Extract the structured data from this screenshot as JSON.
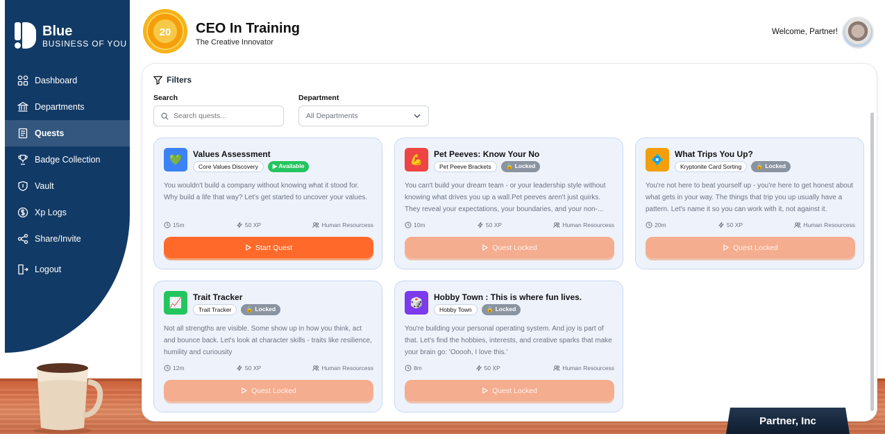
{
  "brand": {
    "title": "Blue",
    "subtitle": "BUSINESS OF YOU"
  },
  "sidebar": {
    "items": [
      {
        "label": "Dashboard",
        "icon": "grid-icon"
      },
      {
        "label": "Departments",
        "icon": "building-icon"
      },
      {
        "label": "Quests",
        "icon": "scroll-icon",
        "active": true
      },
      {
        "label": "Badge Collection",
        "icon": "trophy-icon"
      },
      {
        "label": "Vault",
        "icon": "shield-icon"
      },
      {
        "label": "Xp Logs",
        "icon": "dollar-icon"
      },
      {
        "label": "Share/Invite",
        "icon": "share-icon"
      },
      {
        "label": "Logout",
        "icon": "logout-icon"
      }
    ]
  },
  "header": {
    "level": "20",
    "title": "CEO In Training",
    "subtitle": "The Creative Innovator",
    "welcome": "Welcome, Partner!"
  },
  "filters": {
    "heading": "Filters",
    "search_label": "Search",
    "search_placeholder": "Search quests...",
    "department_label": "Department",
    "department_value": "All Departments"
  },
  "quests": [
    {
      "title": "Values Assessment",
      "tag": "Core Values Discovery",
      "status": "Available",
      "icon_char": "💚",
      "icon_color": "#3b82f6",
      "desc": "You wouldn't build a company without knowing what it stood for. Why build a life that way? Let's get started to uncover your values.",
      "duration": "15m",
      "xp": "50 XP",
      "dept": "Human Resourcess",
      "cta": "Start Quest"
    },
    {
      "title": "Pet Peeves: Know Your No",
      "tag": "Pet Peeve Brackets",
      "status": "Locked",
      "icon_char": "💪",
      "icon_color": "#ef4444",
      "desc": "You can't build your dream team - or your leadership style without knowing what drives you up a wall.Pet peeves aren't just quirks. They reveal your expectations, your boundaries, and your non-...",
      "duration": "10m",
      "xp": "50 XP",
      "dept": "Human Resourcess",
      "cta": "Quest Locked"
    },
    {
      "title": "What Trips You Up?",
      "tag": "Kryptonite Card Sorting",
      "status": "Locked",
      "icon_char": "💠",
      "icon_color": "#f59e0b",
      "desc": "You're not here to beat yourself up - you're here to get honest about what gets in your way. The things that trip you up usually have a pattern. Let's name it so you can work with it, not against it.",
      "duration": "20m",
      "xp": "50 XP",
      "dept": "Human Resourcess",
      "cta": "Quest Locked"
    },
    {
      "title": "Trait Tracker",
      "tag": "Trait Tracker",
      "status": "Locked",
      "icon_char": "📈",
      "icon_color": "#22c55e",
      "desc": "Not all strengths are visible. Some show up in how you think, act and bounce back. Let's look at character skills - traits like resilience, humility and curiousity",
      "duration": "12m",
      "xp": "50 XP",
      "dept": "Human Resourcess",
      "cta": "Quest Locked"
    },
    {
      "title": "Hobby Town : This is where fun lives.",
      "tag": "Hobby Town",
      "status": "Locked",
      "icon_char": "🎲",
      "icon_color": "#7c3aed",
      "desc": "You're building your personal operating system. And joy is part of that. Let's find the hobbies, interests, and creative sparks that make your brain go: 'Ooooh, I love this.'",
      "duration": "8m",
      "xp": "50 XP",
      "dept": "Human Resourcess",
      "cta": "Quest Locked"
    }
  ],
  "nameplate": "Partner, Inc",
  "colors": {
    "sidebar": "#123a66",
    "accent": "#ff6a2b",
    "locked_cta": "#f5ad8f",
    "card_bg": "#eef3fb"
  }
}
